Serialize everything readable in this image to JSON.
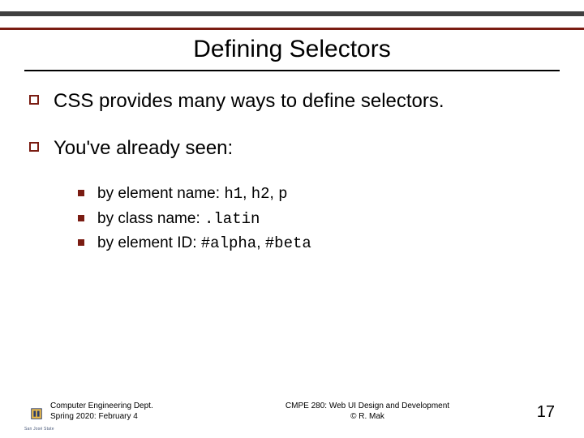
{
  "title": "Defining Selectors",
  "bullets": [
    {
      "text": "CSS provides many ways to define selectors."
    },
    {
      "text": "You've already seen:"
    }
  ],
  "subbullets": [
    {
      "label": "by element name: ",
      "code1": "h1",
      "sep1": ", ",
      "code2": "h2",
      "sep2": ", ",
      "code3": "p"
    },
    {
      "label": "by class name: ",
      "code1": ".latin"
    },
    {
      "label": "by element ID: ",
      "code1": "#alpha",
      "sep1": ", ",
      "code2": "#beta"
    }
  ],
  "footer": {
    "left_line1": "Computer Engineering Dept.",
    "left_line2": "Spring 2020: February 4",
    "center_line1": "CMPE 280: Web UI Design and Development",
    "center_line2": "© R. Mak",
    "page": "17",
    "logo_text": "San José State"
  }
}
